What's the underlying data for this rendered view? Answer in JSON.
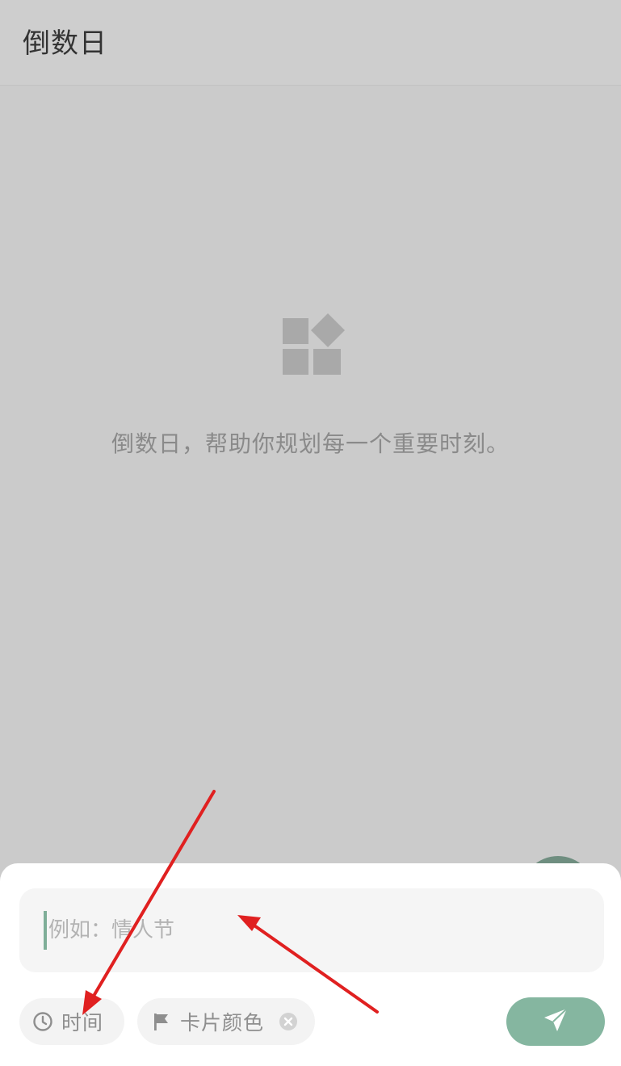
{
  "header": {
    "title": "倒数日"
  },
  "empty_state": {
    "icon": "widgets-icon",
    "message": "倒数日，帮助你规划每一个重要时刻。"
  },
  "add_sheet": {
    "name_input": {
      "value": "",
      "placeholder": "例如：情人节"
    },
    "time_chip": {
      "icon": "clock-icon",
      "label": "时间"
    },
    "color_chip": {
      "icon": "flag-icon",
      "label": "卡片颜色",
      "clear_icon": "close-circle-icon"
    },
    "send_button": {
      "icon": "send-icon"
    }
  },
  "colors": {
    "background_dim": "#cbcbcb",
    "accent": "#85b6a0",
    "caret": "#7fae98",
    "annotation": "#e02020"
  }
}
